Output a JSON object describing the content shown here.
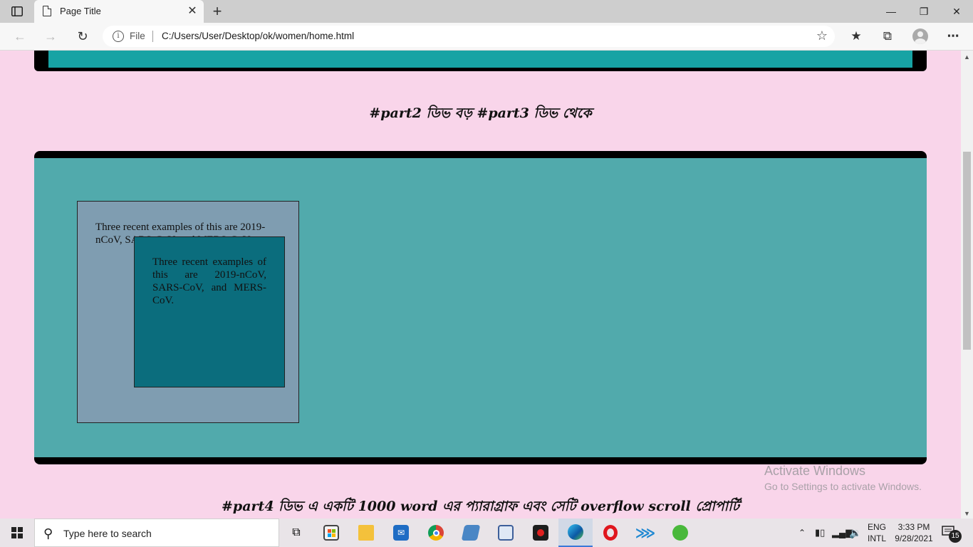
{
  "browser": {
    "tab_title": "Page Title",
    "tab_close": "✕",
    "new_tab": "+",
    "address_prefix": "File",
    "url": "C:/Users/User/Desktop/ok/women/home.html"
  },
  "page": {
    "heading_part2": "#part2 ডিভ বড় #part3 ডিভ থেকে",
    "outer_text": "Three recent examples of this are 2019-nCoV, SARS-CoV, and MERS-CoV.",
    "inner_text": "Three recent examples of this are 2019-nCoV, SARS-CoV, and MERS-CoV.",
    "heading_part4": "#part4 ডিভ এ একটি 1000 word এর প্যারাগ্রাফ এবং সেটি overflow scroll প্রোপার্টি"
  },
  "watermark": {
    "title": "Activate Windows",
    "subtitle": "Go to Settings to activate Windows."
  },
  "taskbar": {
    "search_placeholder": "Type here to search",
    "lang_line1": "ENG",
    "lang_line2": "INTL",
    "time": "3:33 PM",
    "date": "9/28/2021",
    "notification_count": "15"
  },
  "colors": {
    "page_background": "#f9d5ea",
    "teal_top": "#17a3a4",
    "part3_background": "#51aaac",
    "outer_box": "#7f9db1",
    "inner_box": "#0b6d7d"
  }
}
